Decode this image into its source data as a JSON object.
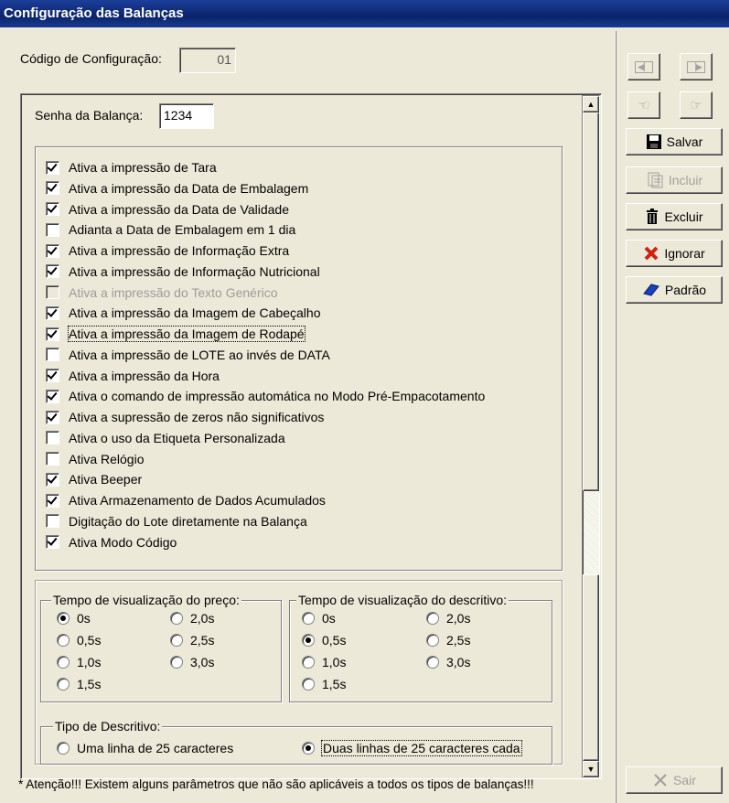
{
  "window": {
    "title": "Configuração das Balanças"
  },
  "config": {
    "label": "Código de Configuração:",
    "value": "01"
  },
  "senha": {
    "label": "Senha da Balança:",
    "value": "1234"
  },
  "options": [
    {
      "label": "Ativa a impressão de Tara",
      "checked": true,
      "enabled": true
    },
    {
      "label": "Ativa a impressão da Data de Embalagem",
      "checked": true,
      "enabled": true
    },
    {
      "label": "Ativa a impressão da Data de Validade",
      "checked": true,
      "enabled": true
    },
    {
      "label": "Adianta a Data de Embalagem em 1 dia",
      "checked": false,
      "enabled": true
    },
    {
      "label": "Ativa a impressão de Informação Extra",
      "checked": true,
      "enabled": true
    },
    {
      "label": "Ativa a impressão de Informação Nutricional",
      "checked": true,
      "enabled": true
    },
    {
      "label": "Ativa a impressão do Texto Genérico",
      "checked": false,
      "enabled": false
    },
    {
      "label": "Ativa a impressão da Imagem de  Cabeçalho",
      "checked": true,
      "enabled": true
    },
    {
      "label": "Ativa a impressão da Imagem de  Rodapé",
      "checked": true,
      "enabled": true
    },
    {
      "label": "Ativa a impressão de LOTE ao invés de DATA",
      "checked": false,
      "enabled": true
    },
    {
      "label": "Ativa a impressão da Hora",
      "checked": true,
      "enabled": true
    },
    {
      "label": "Ativa o comando de impressão automática no Modo Pré-Empacotamento",
      "checked": true,
      "enabled": true
    },
    {
      "label": "Ativa a supressão de zeros não significativos",
      "checked": true,
      "enabled": true
    },
    {
      "label": "Ativa o uso da Etiqueta Personalizada",
      "checked": false,
      "enabled": true
    },
    {
      "label": "Ativa Relógio",
      "checked": false,
      "enabled": true
    },
    {
      "label": "Ativa Beeper",
      "checked": true,
      "enabled": true
    },
    {
      "label": "Ativa Armazenamento de Dados Acumulados",
      "checked": true,
      "enabled": true
    },
    {
      "label": "Digitação do Lote diretamente na Balança",
      "checked": false,
      "enabled": true
    },
    {
      "label": "Ativa Modo Código",
      "checked": true,
      "enabled": true
    }
  ],
  "preco": {
    "title": "Tempo de visualização do preço:",
    "options": [
      "0s",
      "2,0s",
      "0,5s",
      "2,5s",
      "1,0s",
      "3,0s",
      "1,5s"
    ],
    "selected": "0s"
  },
  "descritivo": {
    "title": "Tempo de visualização do descritivo:",
    "options": [
      "0s",
      "2,0s",
      "0,5s",
      "2,5s",
      "1,0s",
      "3,0s",
      "1,5s"
    ],
    "selected": "0,5s"
  },
  "tipo": {
    "title": "Tipo de Descritivo:",
    "option1": "Uma linha de 25 caracteres",
    "option2": "Duas linhas de 25 caracteres cada",
    "selected": 2
  },
  "buttons": {
    "salvar": "Salvar",
    "incluir": "Incluir",
    "excluir": "Excluir",
    "ignorar": "Ignorar",
    "padrao": "Padrão",
    "sair": "Sair"
  },
  "footer": "* Atenção!!! Existem alguns parâmetros que não são aplicáveis a todos os tipos de balanças!!!"
}
